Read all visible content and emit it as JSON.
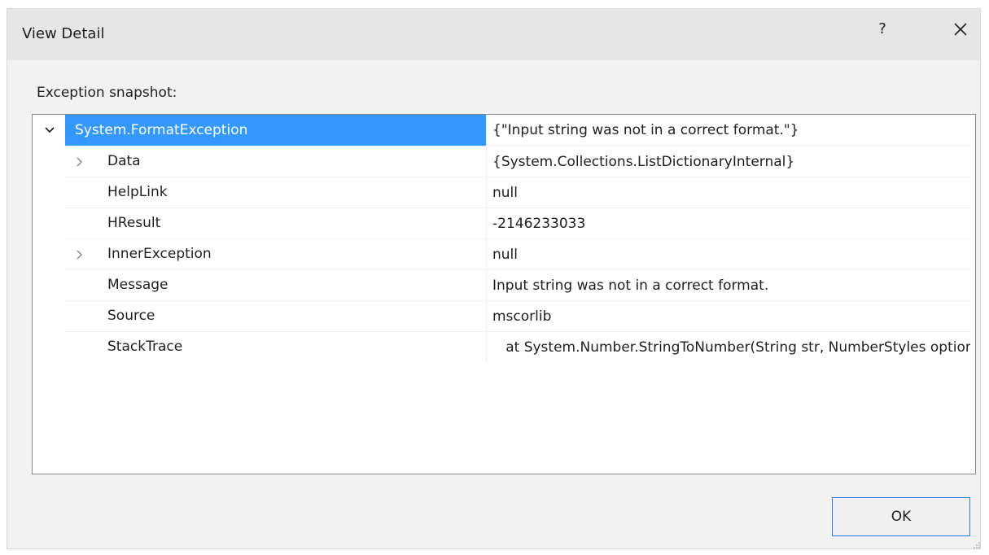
{
  "dialog": {
    "title": "View Detail",
    "help_label": "?",
    "close_icon": "close-icon",
    "snapshot_label": "Exception snapshot:",
    "ok_label": "OK"
  },
  "grid": {
    "root": {
      "name": "System.FormatException",
      "value": "{\"Input string was not in a correct format.\"}",
      "expanded": true
    },
    "rows": [
      {
        "name": "Data",
        "value": "{System.Collections.ListDictionaryInternal}",
        "expandable": true
      },
      {
        "name": "HelpLink",
        "value": "null",
        "expandable": false
      },
      {
        "name": "HResult",
        "value": "-2146233033",
        "expandable": false
      },
      {
        "name": "InnerException",
        "value": "null",
        "expandable": true
      },
      {
        "name": "Message",
        "value": "Input string was not in a correct format.",
        "expandable": false
      },
      {
        "name": "Source",
        "value": "mscorlib",
        "expandable": false
      },
      {
        "name": "StackTrace",
        "value": "   at System.Number.StringToNumber(String str, NumberStyles options, NumberBuffer& number, NumberFormatInfo info, Boolean parseDecimal)",
        "expandable": false
      }
    ]
  },
  "colors": {
    "selection": "#3399ff",
    "titlebar": "#e6e6e6",
    "dialog_bg": "#f2f2f2",
    "ok_border": "#2b79d9"
  }
}
